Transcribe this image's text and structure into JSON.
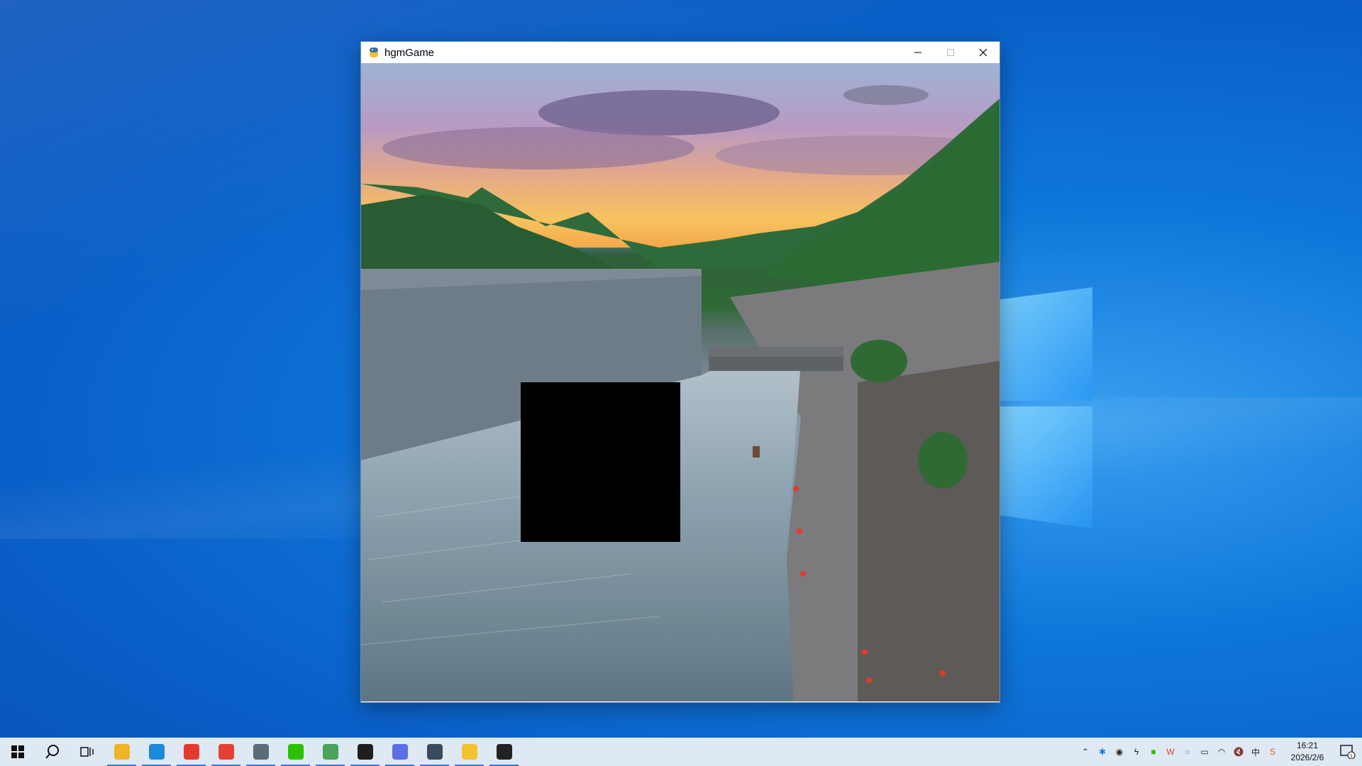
{
  "window": {
    "title": "hgmGame",
    "buttons": {
      "minimize": "−",
      "maximize": "□",
      "close": "✕"
    }
  },
  "game": {
    "grid_size": 4,
    "empty_tile": {
      "row": 2,
      "col": 1
    }
  },
  "taskbar": {
    "apps": [
      {
        "name": "file-explorer",
        "color": "#f0b429"
      },
      {
        "name": "edge",
        "color": "#1b8ad8"
      },
      {
        "name": "wps",
        "color": "#e23b2e"
      },
      {
        "name": "chrome",
        "color": "#e44134"
      },
      {
        "name": "calculator",
        "color": "#5c6b7a"
      },
      {
        "name": "wechat",
        "color": "#2dc100"
      },
      {
        "name": "editor",
        "color": "#49a35a"
      },
      {
        "name": "terminal",
        "color": "#1e1e1e"
      },
      {
        "name": "browser",
        "color": "#5a6ee6"
      },
      {
        "name": "thunder",
        "color": "#3a4a5a"
      },
      {
        "name": "python-game",
        "color": "#f2c230"
      },
      {
        "name": "qq",
        "color": "#222"
      }
    ],
    "clock": {
      "time": "16:21",
      "date": "2026/2/6"
    },
    "notifications_count": "1"
  },
  "colors": {
    "taskbar_bg": "#dfe9f3",
    "accent": "#3b78d8"
  }
}
